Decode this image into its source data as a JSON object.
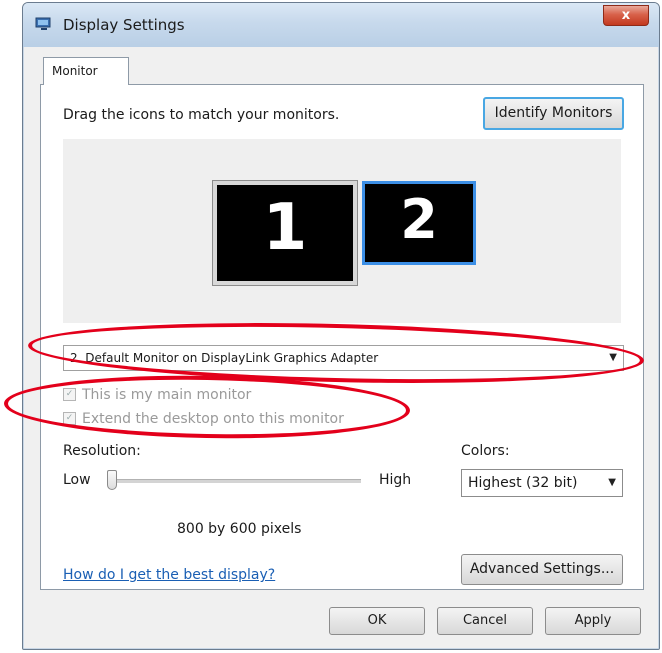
{
  "window": {
    "title": "Display Settings",
    "close_glyph": "x",
    "icon": "display-settings-icon"
  },
  "tabs": [
    {
      "label": "Monitor",
      "active": true
    }
  ],
  "monitor_tab": {
    "instruction": "Drag the icons to match your monitors.",
    "identify_button": "Identify Monitors",
    "monitors": [
      {
        "number": "1",
        "selected": false
      },
      {
        "number": "2",
        "selected": true
      }
    ],
    "monitor_select": {
      "value": "2. Default Monitor on DisplayLink Graphics Adapter"
    },
    "main_monitor_checkbox": {
      "label": "This is my main monitor",
      "checked": true,
      "enabled": false
    },
    "extend_checkbox": {
      "label": "Extend the desktop onto this monitor",
      "checked": true,
      "enabled": false
    },
    "resolution": {
      "label": "Resolution:",
      "low": "Low",
      "high": "High",
      "value_text": "800 by 600 pixels",
      "slider_level": 0
    },
    "colors": {
      "label": "Colors:",
      "value": "Highest (32 bit)"
    },
    "help_link": "How do I get the best display?",
    "advanced_button": "Advanced Settings..."
  },
  "footer": {
    "ok": "OK",
    "cancel": "Cancel",
    "apply": "Apply"
  },
  "colors_theme": {
    "annotation": "#e3001b",
    "selected_monitor_border": "#3c8fe6",
    "link": "#1a5fb4"
  }
}
